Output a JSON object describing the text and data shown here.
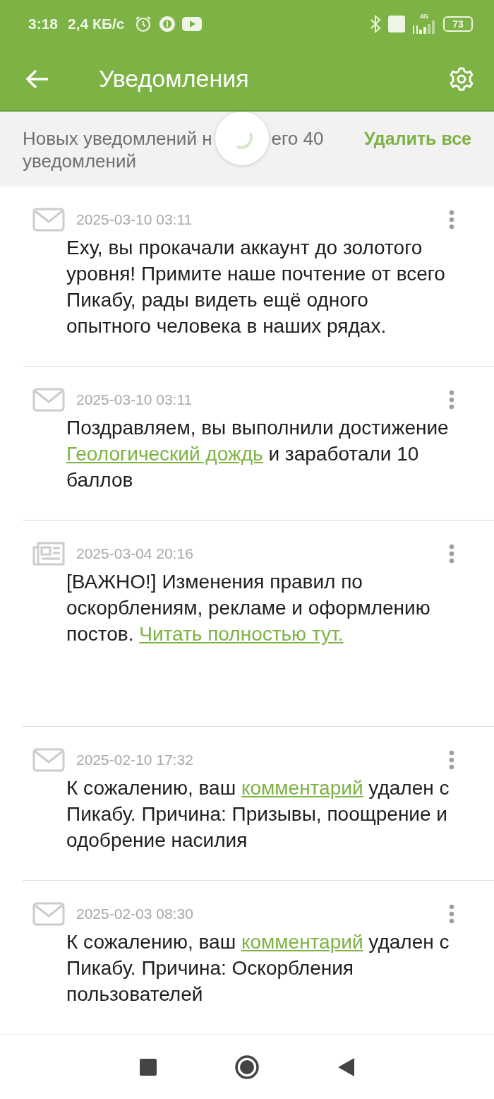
{
  "status_bar": {
    "time": "3:18",
    "speed": "2,4 КБ/с",
    "network": "4G",
    "battery": "73"
  },
  "app_bar": {
    "title": "Уведомления"
  },
  "summary": {
    "visible_parts": [
      "Новых уведомлений н",
      "его 40",
      "уведомлений"
    ],
    "action": "Удалить все",
    "loading": true
  },
  "notifications": [
    {
      "kind": "mail",
      "time": "2025-03-10 03:11",
      "parts": [
        {
          "text": "Еху, вы прокачали аккаунт до золотого уровня! Примите наше почтение от всего Пикабу, рады видеть ещё одного опытного человека в наших рядах.",
          "link": false
        }
      ]
    },
    {
      "kind": "mail",
      "time": "2025-03-10 03:11",
      "parts": [
        {
          "text": "Поздравляем, вы выполнили достижение ",
          "link": false
        },
        {
          "text": "Геологический дождь",
          "link": true
        },
        {
          "text": " и заработали 10 баллов",
          "link": false
        }
      ]
    },
    {
      "kind": "news",
      "time": "2025-03-04 20:16",
      "parts": [
        {
          "text": "[ВАЖНО!] Изменения правил по оскорблениям, рекламе и оформлению постов. ",
          "link": false
        },
        {
          "text": "Читать полностью тут.",
          "link": true
        }
      ]
    },
    {
      "kind": "mail",
      "time": "2025-02-10 17:32",
      "parts": [
        {
          "text": "К сожалению, ваш ",
          "link": false
        },
        {
          "text": "комментарий",
          "link": true
        },
        {
          "text": " удален с Пикабу. Причина: Призывы, поощрение и одобрение насилия",
          "link": false
        }
      ]
    },
    {
      "kind": "mail",
      "time": "2025-02-03 08:30",
      "parts": [
        {
          "text": "К сожалению, ваш ",
          "link": false
        },
        {
          "text": "комментарий",
          "link": true
        },
        {
          "text": " удален с Пикабу. Причина: Оскорбления пользователей",
          "link": false
        }
      ]
    }
  ]
}
